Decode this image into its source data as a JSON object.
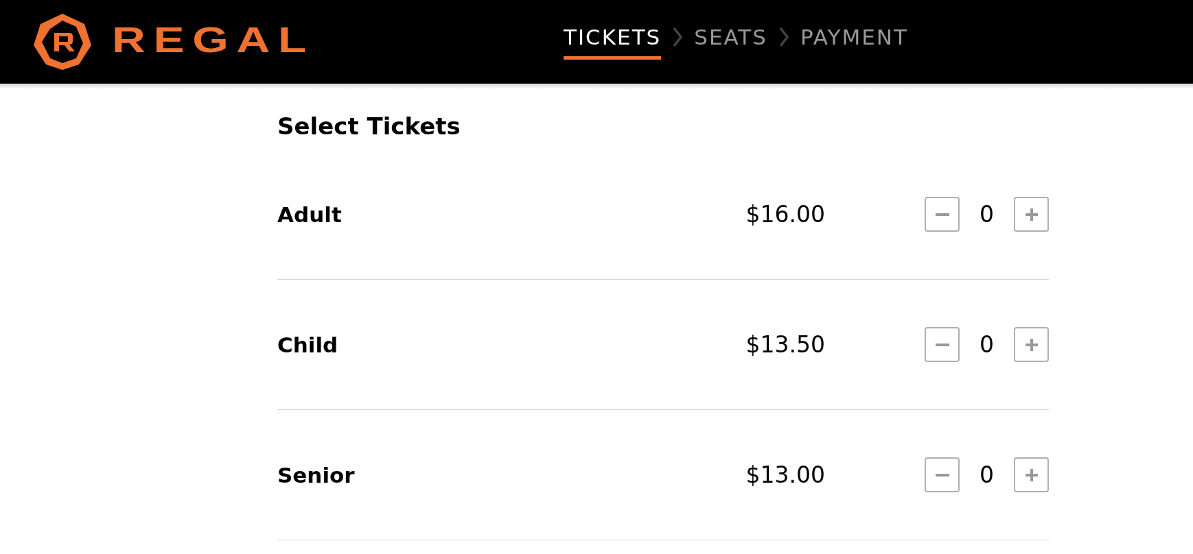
{
  "header": {
    "brand": "REGAL",
    "steps": [
      {
        "label": "TICKETS",
        "selected": true
      },
      {
        "label": "SEATS",
        "selected": false
      },
      {
        "label": "PAYMENT",
        "selected": false
      }
    ]
  },
  "title": "Select Tickets",
  "tickets": [
    {
      "name": "Adult",
      "price": "$16.00",
      "count": "0"
    },
    {
      "name": "Child",
      "price": "$13.50",
      "count": "0"
    },
    {
      "name": "Senior",
      "price": "$13.00",
      "count": "0"
    }
  ]
}
